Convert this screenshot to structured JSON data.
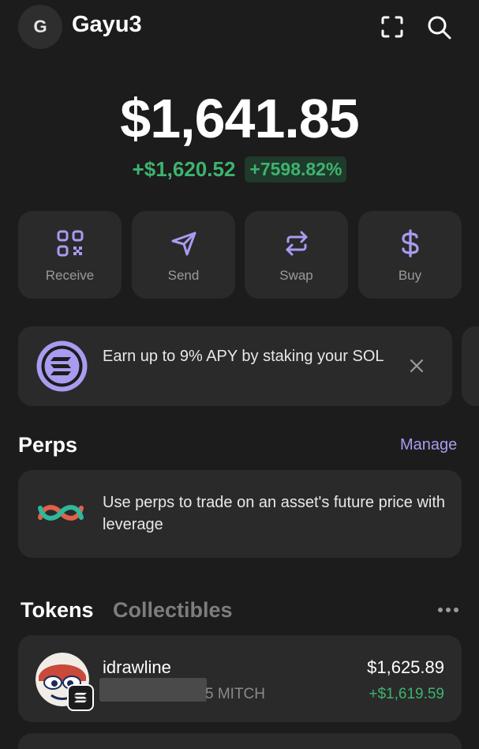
{
  "header": {
    "avatar_initial": "G",
    "account_name": "Gayu3",
    "icons": [
      "scan-icon",
      "search-icon"
    ]
  },
  "balance": {
    "total": "$1,641.85",
    "change_abs": "+$1,620.52",
    "change_pct": "+7598.82%"
  },
  "actions": [
    {
      "label": "Receive",
      "icon": "qr-code-icon"
    },
    {
      "label": "Send",
      "icon": "send-icon"
    },
    {
      "label": "Swap",
      "icon": "swap-icon"
    },
    {
      "label": "Buy",
      "icon": "dollar-icon"
    }
  ],
  "banner": {
    "text": "Earn up to 9% APY by staking your SOL",
    "icon": "solana-icon"
  },
  "perps": {
    "title": "Perps",
    "manage_label": "Manage",
    "text": "Use perps to trade on an asset's future price with leverage"
  },
  "tabs": {
    "tokens": "Tokens",
    "collectibles": "Collectibles"
  },
  "tokens": [
    {
      "name": "idrawline",
      "amount_suffix": "5 MITCH",
      "value": "$1,625.89",
      "change": "+$1,619.59"
    }
  ],
  "colors": {
    "background": "#1c1c1c",
    "card": "#2a2a2a",
    "accent_purple": "#a99bf0",
    "positive_green": "#3db36f"
  }
}
